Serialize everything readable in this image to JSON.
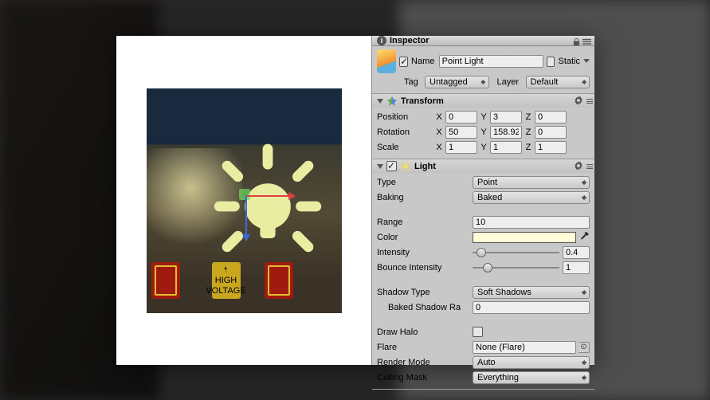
{
  "inspector": {
    "tab_label": "Inspector",
    "name_label": "Name",
    "object_name": "Point Light",
    "static_label": "Static",
    "tag_label": "Tag",
    "tag_value": "Untagged",
    "layer_label": "Layer",
    "layer_value": "Default"
  },
  "transform": {
    "title": "Transform",
    "position_label": "Position",
    "rotation_label": "Rotation",
    "scale_label": "Scale",
    "x": "X",
    "y": "Y",
    "z": "Z",
    "position": {
      "x": "0",
      "y": "3",
      "z": "0"
    },
    "rotation": {
      "x": "50",
      "y": "158.92",
      "z": "0"
    },
    "scale": {
      "x": "1",
      "y": "1",
      "z": "1"
    }
  },
  "light": {
    "title": "Light",
    "type_label": "Type",
    "type_value": "Point",
    "baking_label": "Baking",
    "baking_value": "Baked",
    "range_label": "Range",
    "range_value": "10",
    "color_label": "Color",
    "color_value": "#fffdd8",
    "intensity_label": "Intensity",
    "intensity_value": "0.4",
    "intensity_thumb_pct": 5,
    "bounce_label": "Bounce Intensity",
    "bounce_value": "1",
    "bounce_thumb_pct": 12,
    "shadow_type_label": "Shadow Type",
    "shadow_type_value": "Soft Shadows",
    "baked_shadow_label": "Baked Shadow Ra",
    "baked_shadow_value": "0",
    "draw_halo_label": "Draw Halo",
    "flare_label": "Flare",
    "flare_value": "None (Flare)",
    "render_mode_label": "Render Mode",
    "render_mode_value": "Auto",
    "culling_label": "Culling Mask",
    "culling_value": "Everything"
  },
  "signs": {
    "high": "HIGH",
    "voltage": "VOLTAGE"
  }
}
